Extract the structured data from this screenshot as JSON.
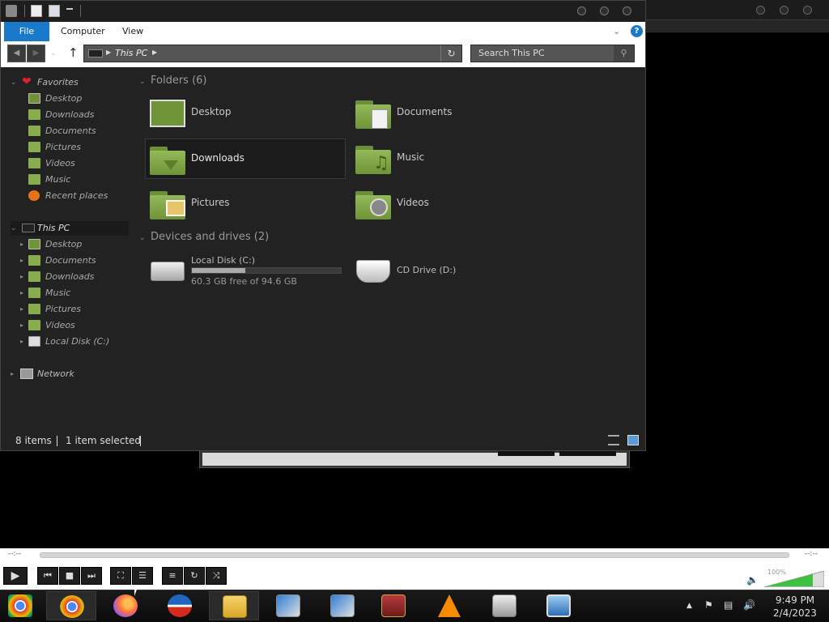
{
  "explorer": {
    "ribbon_tabs": [
      "File",
      "Computer",
      "View"
    ],
    "address": {
      "crumb": "This PC"
    },
    "search": {
      "placeholder": "Search This PC"
    },
    "nav": {
      "favorites": {
        "header": "Favorites",
        "items": [
          "Desktop",
          "Downloads",
          "Documents",
          "Pictures",
          "Videos",
          "Music",
          "Recent places"
        ]
      },
      "this_pc": {
        "header": "This PC",
        "items": [
          "Desktop",
          "Documents",
          "Downloads",
          "Music",
          "Pictures",
          "Videos",
          "Local Disk (C:)"
        ]
      },
      "network": "Network"
    },
    "folders_group": "Folders (6)",
    "folders": [
      "Desktop",
      "Documents",
      "Downloads",
      "Music",
      "Pictures",
      "Videos"
    ],
    "selected_folder": "Downloads",
    "drives_group": "Devices and drives (2)",
    "drives": [
      {
        "name": "Local Disk (C:)",
        "free": "60.3 GB free of 94.6 GB",
        "used_fraction": 0.36
      },
      {
        "name": "CD Drive (D:)"
      }
    ],
    "status": {
      "items": "8 items",
      "selected": "1 item selected"
    }
  },
  "player": {
    "elapsed": "--:--",
    "remaining": "--:--",
    "volume": "100%"
  },
  "taskbar": {
    "apps": [
      "chrome-alt-icon",
      "chrome-icon",
      "firefox-icon",
      "obama-icon",
      "file-explorer-icon",
      "installer-icon",
      "installer-2-icon",
      "winrar-icon",
      "vlc-icon",
      "system-monitor-icon",
      "photo-viewer-icon"
    ],
    "time": "9:49 PM",
    "date": "2/4/2023"
  },
  "colors": {
    "accent": "#1979ca",
    "folder_green": "#87ad4c",
    "heart": "#e0202a"
  }
}
